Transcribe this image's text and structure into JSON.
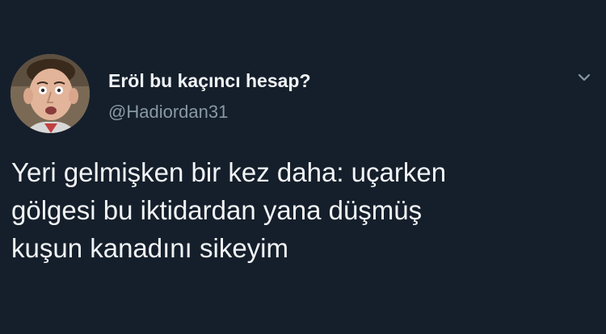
{
  "tweet": {
    "author": {
      "display_name": "Eröl bu kaçıncı hesap?",
      "handle": "@Hadiordan31"
    },
    "text": "Yeri gelmişken bir kez daha: uçarken\ngölgesi bu iktidardan yana düşmüş\nkuşun kanadını sikeyim"
  },
  "icons": {
    "avatar": "profile-photo",
    "caret": "chevron-down-icon"
  },
  "colors": {
    "background": "#151f2b",
    "text": "#f2f4f6",
    "secondary_text": "#8899a6"
  }
}
